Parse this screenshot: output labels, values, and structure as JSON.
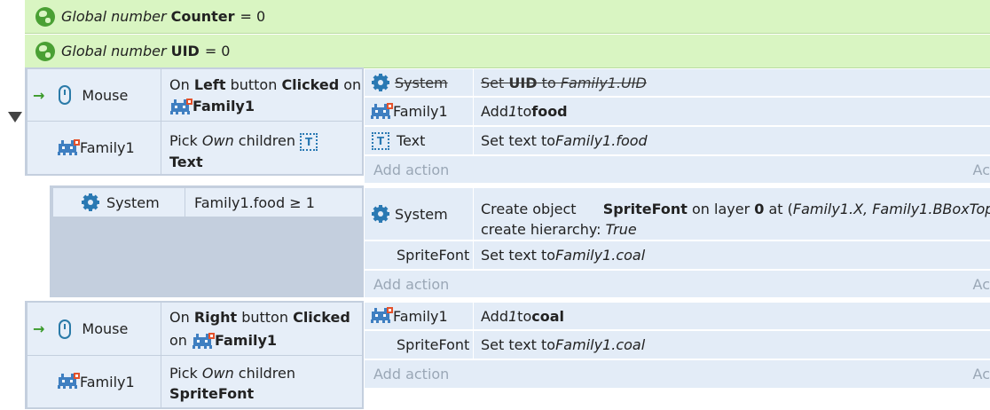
{
  "globals": [
    {
      "prefix": "Global number",
      "name": "Counter",
      "value": "= 0"
    },
    {
      "prefix": "Global number",
      "name": "UID",
      "value": "= 0"
    }
  ],
  "events": [
    {
      "conditions": [
        {
          "object": "Mouse",
          "text": {
            "a": "On ",
            "b": "Left",
            "c": " button ",
            "d": "Clicked",
            "e": " on",
            "f": "Family1"
          }
        },
        {
          "object": "Family1",
          "text": {
            "a": "Pick ",
            "b": "Own",
            "c": " children",
            "d": "Text"
          }
        }
      ],
      "actions": [
        {
          "object": "System",
          "text": {
            "a": "Set ",
            "b": "UID",
            "c": " to ",
            "d": "Family1.UID"
          },
          "disabled": true
        },
        {
          "object": "Family1",
          "text": {
            "a": "Add ",
            "b": "1",
            "c": " to ",
            "d": "food"
          }
        },
        {
          "object": "Text",
          "text": {
            "a": "Set text to ",
            "b": "Family1.food"
          }
        }
      ],
      "add_action": "Add action",
      "add_action_right": "Ac"
    },
    {
      "conditions": [
        {
          "object": "System",
          "text": "Family1.food ≥ 1"
        }
      ],
      "actions": [
        {
          "object": "System",
          "text": {
            "a": "Create object ",
            "b": "SpriteFont",
            "c": " on layer ",
            "d": "0",
            "e": " at (",
            "f": "Family1.X, Family1.BBoxTop",
            "g": "),",
            "h": "create hierarchy: ",
            "i": "True"
          }
        },
        {
          "object": "SpriteFont",
          "text": {
            "a": "Set text to ",
            "b": "Family1.coal"
          }
        }
      ],
      "add_action": "Add action",
      "add_action_right": "Ac"
    },
    {
      "conditions": [
        {
          "object": "Mouse",
          "text": {
            "a": "On ",
            "b": "Right",
            "c": " button ",
            "d": "Clicked",
            "e": "on ",
            "f": "Family1"
          }
        },
        {
          "object": "Family1",
          "text": {
            "a": "Pick ",
            "b": "Own",
            "c": " children",
            "d": "SpriteFont"
          }
        }
      ],
      "actions": [
        {
          "object": "Family1",
          "text": {
            "a": "Add ",
            "b": "1",
            "c": " to ",
            "d": "coal"
          }
        },
        {
          "object": "SpriteFont",
          "text": {
            "a": "Set text to ",
            "b": "Family1.coal"
          }
        }
      ],
      "add_action": "Add action",
      "add_action_right": "Ac"
    }
  ]
}
